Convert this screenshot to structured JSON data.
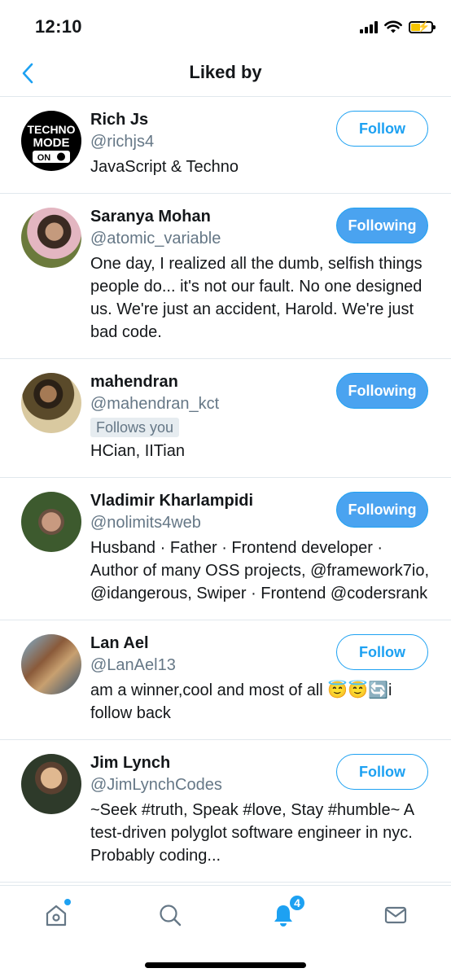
{
  "status_bar": {
    "time": "12:10"
  },
  "header": {
    "title": "Liked by"
  },
  "users": [
    {
      "name": "Rich Js",
      "handle": "@richjs4",
      "follows_you": "",
      "bio": "JavaScript & Techno",
      "button": "Follow",
      "avatar_text": [
        "TECHNO",
        "MODE",
        "ON"
      ]
    },
    {
      "name": "Saranya Mohan",
      "handle": "@atomic_variable",
      "follows_you": "",
      "bio": "One day, I realized all the dumb, selfish things people do... it's not our fault. No one designed us. We're just an accident, Harold. We're just bad code.",
      "button": "Following"
    },
    {
      "name": "mahendran",
      "handle": "@mahendran_kct",
      "follows_you": "Follows you",
      "bio": "HCian, IITian",
      "button": "Following"
    },
    {
      "name": "Vladimir Kharlampidi",
      "handle": "@nolimits4web",
      "follows_you": "",
      "bio": "Husband · Father · Frontend developer · Author of many OSS projects, @framework7io, @idangerous, Swiper · Frontend @codersrank",
      "button": "Following"
    },
    {
      "name": "Lan Ael",
      "handle": "@LanAel13",
      "follows_you": "",
      "bio": "am a winner,cool and most of all 😇😇🔄i follow back",
      "button": "Follow"
    },
    {
      "name": "Jim Lynch",
      "handle": "@JimLynchCodes",
      "follows_you": "",
      "bio": "~Seek #truth, Speak #love, Stay #humble~ A test-driven polyglot software engineer in nyc. Probably coding...",
      "button": "Follow"
    }
  ],
  "tabbar": {
    "notifications_badge": "4"
  },
  "colors": {
    "accent": "#1da1f2",
    "following_bg": "#4aa3f0",
    "secondary_text": "#657786",
    "divider": "#e1e8ed"
  }
}
